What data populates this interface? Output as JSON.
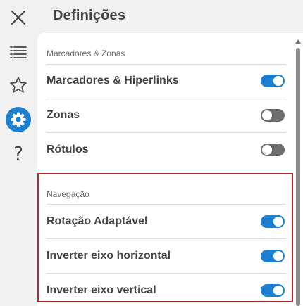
{
  "rail": {
    "close_icon": "close-icon",
    "list_icon": "list-icon",
    "star_icon": "star-icon",
    "settings_icon": "gear-icon",
    "help_glyph": "?"
  },
  "header": {
    "title": "Definições"
  },
  "sections": [
    {
      "label": "Marcadores & Zonas",
      "items": [
        {
          "label": "Marcadores & Hiperlinks",
          "enabled": true
        },
        {
          "label": "Zonas",
          "enabled": false
        },
        {
          "label": "Rótulos",
          "enabled": false
        }
      ]
    },
    {
      "label": "Navegação",
      "items": [
        {
          "label": "Rotação Adaptável",
          "enabled": true
        },
        {
          "label": "Inverter eixo horizontal",
          "enabled": true
        },
        {
          "label": "Inverter eixo vertical",
          "enabled": true
        }
      ]
    }
  ],
  "colors": {
    "accent": "#1d7fd1",
    "toggle_off": "#6e6e6e",
    "highlight": "#b3262b"
  }
}
